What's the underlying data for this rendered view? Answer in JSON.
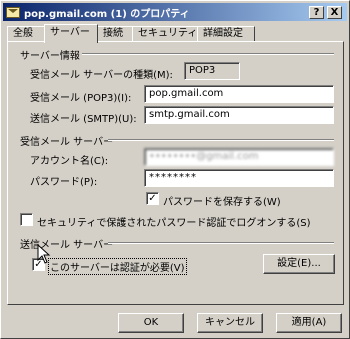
{
  "window": {
    "title": "pop.gmail.com (1) のプロパティ",
    "help_button": "?",
    "close_button": "X"
  },
  "tabs": [
    {
      "label": "全般"
    },
    {
      "label": "サーバー"
    },
    {
      "label": "接続"
    },
    {
      "label": "セキュリティ"
    },
    {
      "label": "詳細設定"
    }
  ],
  "server_info": {
    "heading": "サーバー情報",
    "incoming_type_label": "受信メール サーバーの種類(M):",
    "incoming_type_value": "POP3",
    "incoming_label": "受信メール (POP3)(I):",
    "incoming_value": "pop.gmail.com",
    "outgoing_label": "送信メール (SMTP)(U):",
    "outgoing_value": "smtp.gmail.com"
  },
  "incoming_server": {
    "heading": "受信メール サーバー",
    "account_label": "アカウント名(C):",
    "account_value": "••••••••@gmail.com",
    "password_label": "パスワード(P):",
    "password_value": "********",
    "remember_password": {
      "label": "パスワードを保存する(W)",
      "checked": true,
      "mark": "✓"
    },
    "spa_logon": {
      "label": "セキュリティで保護されたパスワード認証でログオンする(S)",
      "checked": false,
      "mark": ""
    }
  },
  "outgoing_server": {
    "heading": "送信メール サーバー",
    "auth_required": {
      "label": "このサーバーは認証が必要(V)",
      "checked": true,
      "mark": "✓"
    },
    "settings_button": "設定(E)..."
  },
  "footer": {
    "ok": "OK",
    "cancel": "キャンセル",
    "apply": "適用(A)"
  }
}
